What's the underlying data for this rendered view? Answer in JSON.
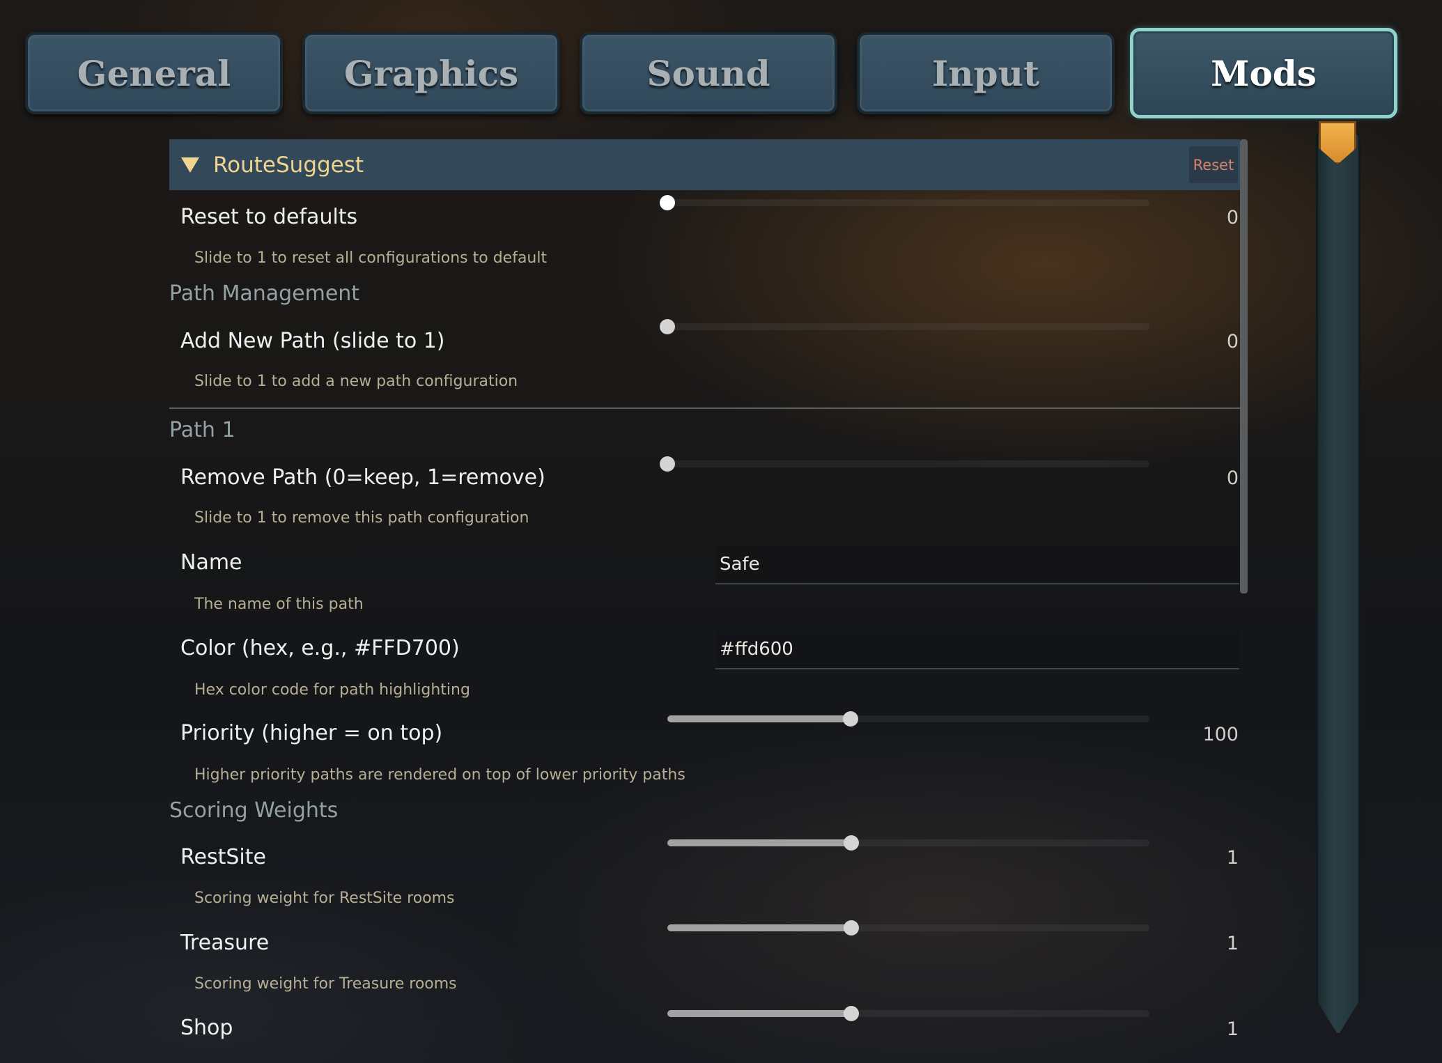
{
  "tabs": {
    "general": "General",
    "graphics": "Graphics",
    "sound": "Sound",
    "input": "Input",
    "mods": "Mods",
    "active": "Mods"
  },
  "section": {
    "title": "RouteSuggest",
    "reset_label": "Reset"
  },
  "settings": {
    "reset_defaults": {
      "label": "Reset to defaults",
      "description": "Slide to 1 to reset all configurations to default",
      "value": "0",
      "fraction": 0
    },
    "path_management_heading": "Path Management",
    "add_new_path": {
      "label": "Add New Path (slide to 1)",
      "description": "Slide to 1 to add a new path configuration",
      "value": "0",
      "fraction": 0
    },
    "path1_heading": "Path 1",
    "remove_path": {
      "label": "Remove Path (0=keep, 1=remove)",
      "description": "Slide to 1 to remove this path configuration",
      "value": "0",
      "fraction": 0
    },
    "name": {
      "label": "Name",
      "description": "The name of this path",
      "value": "Safe"
    },
    "color": {
      "label": "Color (hex, e.g., #FFD700)",
      "description": "Hex color code for path highlighting",
      "value": "#ffd600"
    },
    "priority": {
      "label": "Priority (higher = on top)",
      "description": "Higher priority paths are rendered on top of lower priority paths",
      "value": "100",
      "fraction": 0.38
    },
    "scoring_weights_heading": "Scoring Weights",
    "restsite": {
      "label": "RestSite",
      "description": "Scoring weight for RestSite rooms",
      "value": "1",
      "fraction": 0.382
    },
    "treasure": {
      "label": "Treasure",
      "description": "Scoring weight for Treasure rooms",
      "value": "1",
      "fraction": 0.382
    },
    "shop": {
      "label": "Shop",
      "value": "1",
      "fraction": 0.382
    }
  },
  "colors": {
    "accent_gold": "#efd590",
    "active_tab_border": "#8fd3cc",
    "reset_text": "#d9826c",
    "scroll_marker": "#f0b24c"
  },
  "icons": {
    "section_toggle": "caret-down-icon",
    "scroll_marker": "shield-marker-icon"
  }
}
